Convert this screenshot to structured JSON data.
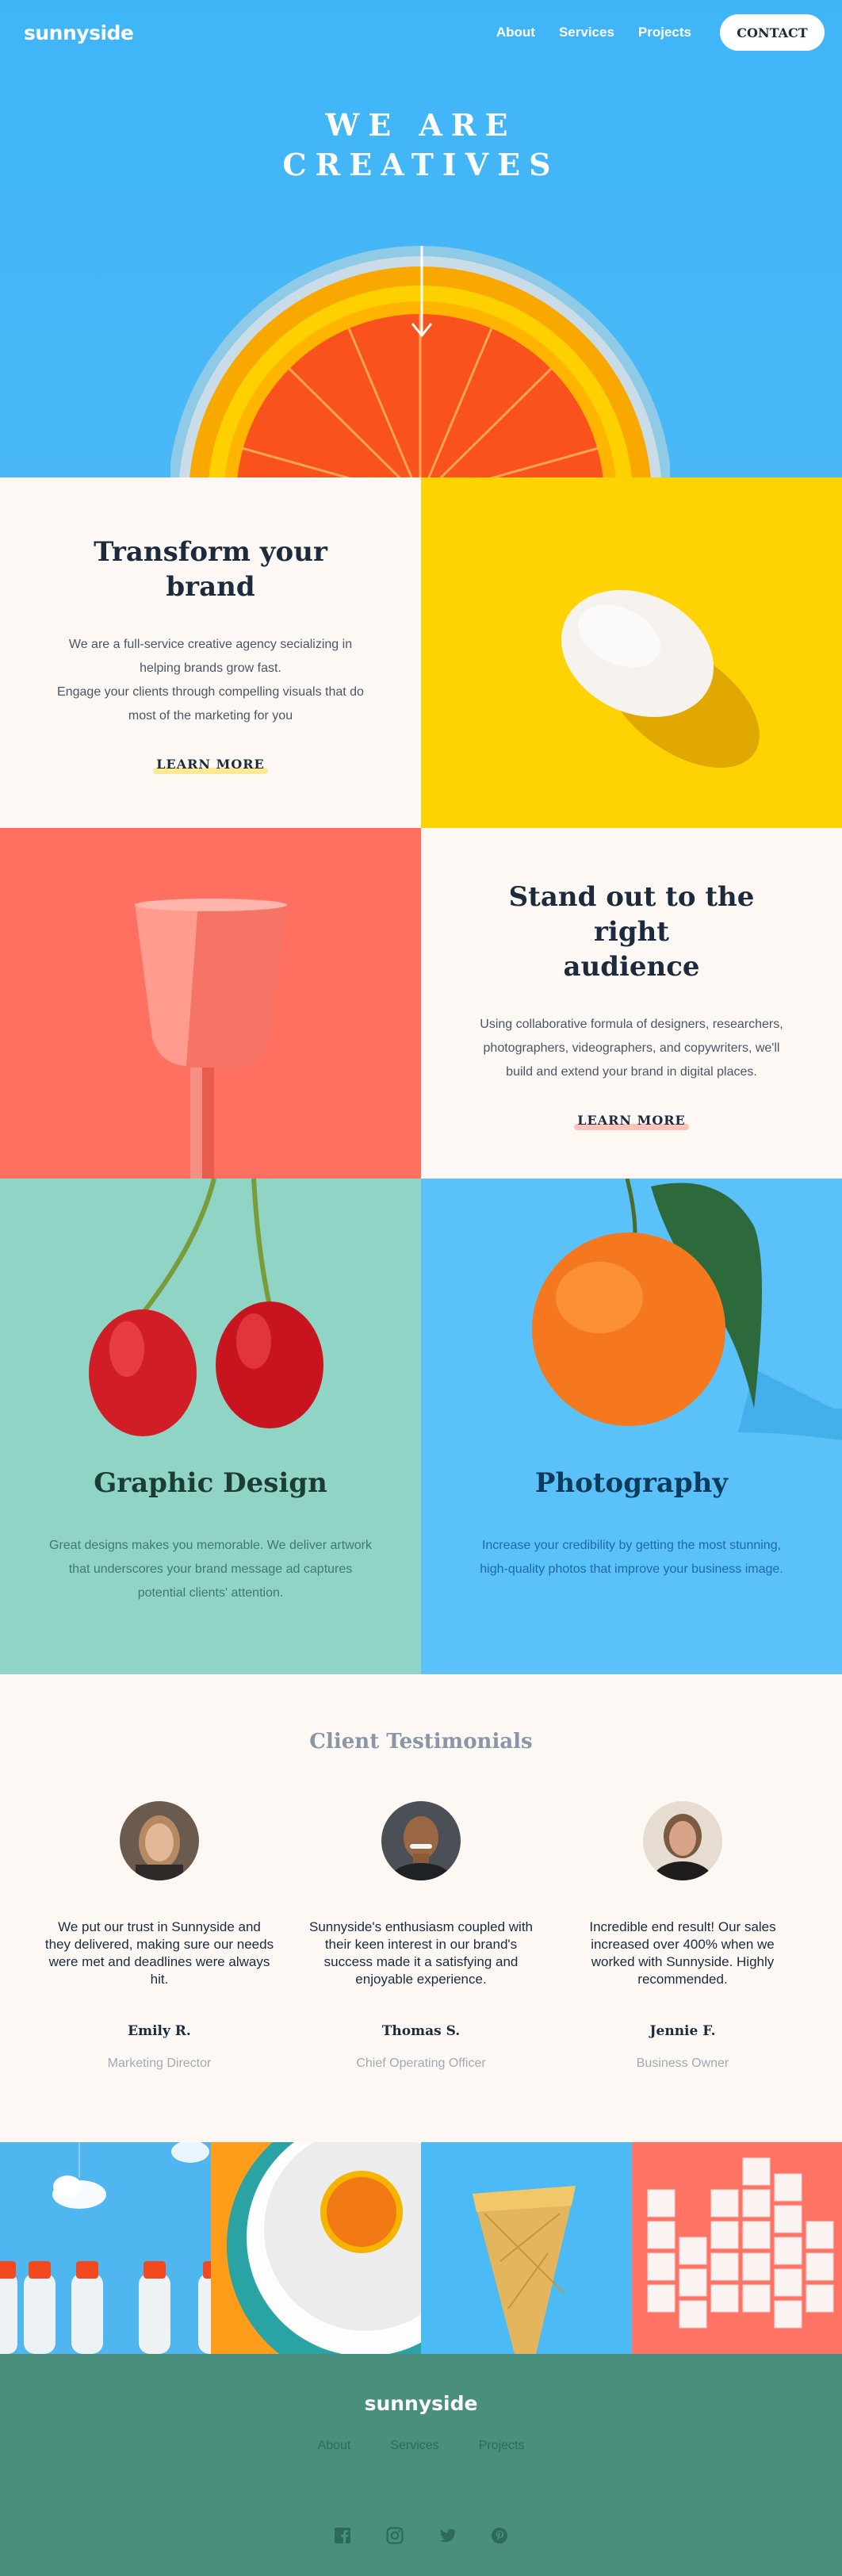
{
  "nav": {
    "logo": "sunnyside",
    "links": [
      "About",
      "Services",
      "Projects"
    ],
    "contact": "CONTACT"
  },
  "hero": {
    "title_line1": "WE ARE",
    "title_line2": "CREATIVES"
  },
  "features": [
    {
      "title": "Transform your brand",
      "desc_line1": "We are a full-service creative agency secializing in",
      "desc_line2": "helping brands grow fast.",
      "desc_line3": "Engage your clients through compelling visuals that do",
      "desc_line4": "most of the marketing for you",
      "cta": "LEARN MORE"
    },
    {
      "title_line1": "Stand out to the right",
      "title_line2": "audience",
      "desc_line1": "Using collaborative formula of designers, researchers,",
      "desc_line2": "photographers, videographers, and copywriters, we'll",
      "desc_line3": "build and extend your brand in digital places.",
      "cta": "LEARN MORE"
    }
  ],
  "services": [
    {
      "title": "Graphic Design",
      "desc_line1": "Great designs makes you memorable. We deliver artwork",
      "desc_line2": "that underscores your brand message ad captures",
      "desc_line3": "potential clients' attention."
    },
    {
      "title": "Photography",
      "desc_line1": "Increase your credibility by getting the most stunning,",
      "desc_line2": "high-quality photos that improve your business image."
    }
  ],
  "testimonials": {
    "heading": "Client Testimonials",
    "items": [
      {
        "quote": "We put our trust in Sunnyside and they delivered, making sure our needs were met and deadlines were always hit.",
        "name": "Emily R.",
        "role": "Marketing Director"
      },
      {
        "quote": "Sunnyside's enthusiasm coupled with their keen interest in our brand's success made it a satisfying and enjoyable experience.",
        "name": "Thomas S.",
        "role": "Chief Operating Officer"
      },
      {
        "quote": "Incredible end result! Our sales increased over 400% when we worked with Sunnyside. Highly recommended.",
        "name": "Jennie F.",
        "role": "Business Owner"
      }
    ]
  },
  "footer": {
    "logo": "sunnyside",
    "links": [
      "About",
      "Services",
      "Projects"
    ],
    "social": [
      "facebook-icon",
      "instagram-icon",
      "twitter-icon",
      "pinterest-icon"
    ]
  },
  "colors": {
    "hero_blue": "#3fb5f8",
    "yellow": "#ffd203",
    "coral": "#ff7060",
    "teal": "#90d4c5",
    "sky": "#5ac2f9",
    "footer_green": "#4a8f7d",
    "dark_blue": "#1b2a3c"
  }
}
